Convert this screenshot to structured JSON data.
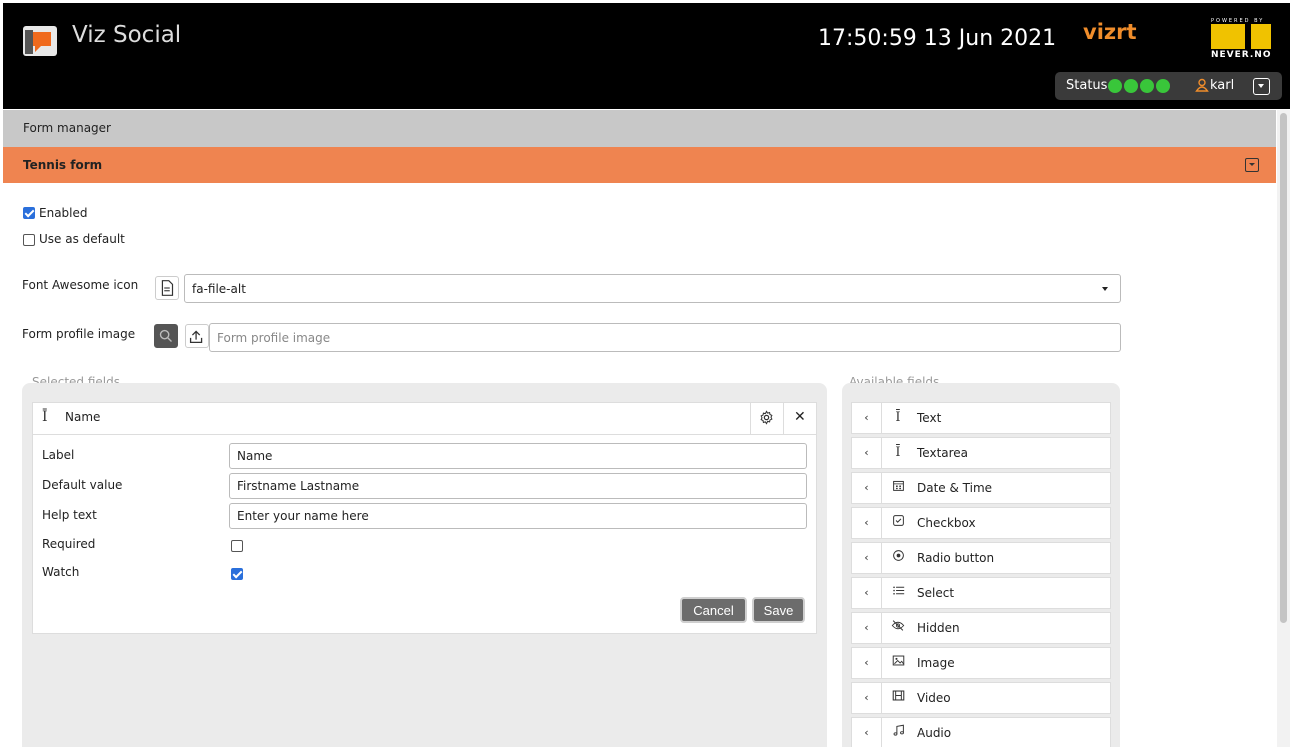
{
  "header": {
    "app_title": "Viz Social",
    "clock": "17:50:59 13 Jun 2021",
    "partner_logo": "vizrt",
    "powered_by": "POWERED BY",
    "powered_brand": "NEVER.NO",
    "status_label": "Status",
    "status_color": "#39c63a",
    "username": "karl"
  },
  "breadcrumb": "Form manager",
  "form": {
    "name": "Tennis form",
    "enabled_label": "Enabled",
    "enabled": true,
    "default_label": "Use as default",
    "use_as_default": false,
    "icon_label": "Font Awesome icon",
    "icon_value": "fa-file-alt",
    "profile_image_label": "Form profile image",
    "profile_image_placeholder": "Form profile image"
  },
  "selected_fields": {
    "title": "Selected fields",
    "card": {
      "name": "Name",
      "label_label": "Label",
      "label_value": "Name",
      "default_label": "Default value",
      "default_value": "Firstname Lastname",
      "help_label": "Help text",
      "help_value": "Enter your name here",
      "required_label": "Required",
      "required": false,
      "watch_label": "Watch",
      "watch": true,
      "cancel": "Cancel",
      "save": "Save"
    }
  },
  "available_fields": {
    "title": "Available fields",
    "items": [
      {
        "label": "Text",
        "icon": "text-cursor-icon"
      },
      {
        "label": "Textarea",
        "icon": "text-cursor-icon"
      },
      {
        "label": "Date & Time",
        "icon": "calendar-icon"
      },
      {
        "label": "Checkbox",
        "icon": "checkbox-icon"
      },
      {
        "label": "Radio button",
        "icon": "radio-icon"
      },
      {
        "label": "Select",
        "icon": "list-icon"
      },
      {
        "label": "Hidden",
        "icon": "eye-slash-icon"
      },
      {
        "label": "Image",
        "icon": "image-icon"
      },
      {
        "label": "Video",
        "icon": "film-icon"
      },
      {
        "label": "Audio",
        "icon": "music-icon"
      }
    ]
  }
}
